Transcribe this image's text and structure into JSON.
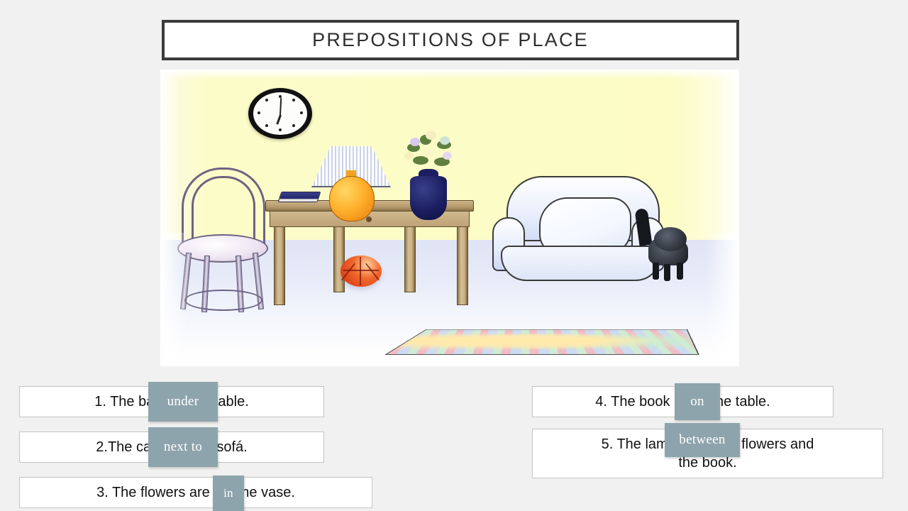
{
  "page": {
    "background_color": "#f1f1f1",
    "title": "PREPOSITIONS OF PLACE"
  },
  "illustration": {
    "name": "living-room-scene",
    "description": "Cartoon living room: clock on wall, wooden table with book, lamp and flower vase, bentwood chair, basketball under the table, armchair with pillow, black cat beside the armchair, patterned rug on the floor.",
    "wall_color": "#fcfcc4",
    "floor_color": "#dfe4f5",
    "objects": [
      "wall-clock",
      "wooden-table",
      "blue-book",
      "table-lamp",
      "flower-vase",
      "bentwood-chair",
      "basketball",
      "armchair-sofa",
      "cushion-pillow",
      "black-cat",
      "patterned-rug"
    ]
  },
  "exercise": {
    "accent_chip_color": "#8ea4ac",
    "chip_text_color": "#ffffff",
    "items": [
      {
        "id": 1,
        "before": "1. The ball is _",
        "answer": "under",
        "after": " the table.",
        "lines": [
          "1. The ball is _          the table."
        ]
      },
      {
        "id": 2,
        "before": "2.The cat is _",
        "answer": "next to",
        "after": ". the sofá.",
        "lines": [
          "2.The cat is _          . the sofá."
        ]
      },
      {
        "id": 3,
        "before": "3. The flowers are _",
        "answer": "in",
        "after": "_ the vase.",
        "lines": [
          "3. The flowers are _      _ the vase."
        ]
      },
      {
        "id": 4,
        "before": "4. The book is _",
        "answer": "on",
        "after": "_ the table.",
        "lines": [
          "4. The book is _        _ the table."
        ]
      },
      {
        "id": 5,
        "before": "5. The lamp is _",
        "answer": "between",
        "after": "_ the flowers and",
        "lines": [
          "5. The lamp is _             _ the flowers and",
          "the book."
        ]
      }
    ]
  }
}
